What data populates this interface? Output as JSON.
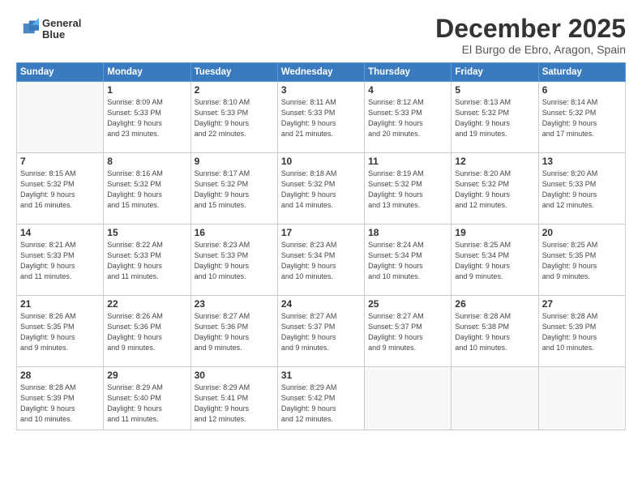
{
  "header": {
    "logo_line1": "General",
    "logo_line2": "Blue",
    "month": "December 2025",
    "location": "El Burgo de Ebro, Aragon, Spain"
  },
  "days_of_week": [
    "Sunday",
    "Monday",
    "Tuesday",
    "Wednesday",
    "Thursday",
    "Friday",
    "Saturday"
  ],
  "weeks": [
    [
      {
        "day": "",
        "info": ""
      },
      {
        "day": "1",
        "info": "Sunrise: 8:09 AM\nSunset: 5:33 PM\nDaylight: 9 hours\nand 23 minutes."
      },
      {
        "day": "2",
        "info": "Sunrise: 8:10 AM\nSunset: 5:33 PM\nDaylight: 9 hours\nand 22 minutes."
      },
      {
        "day": "3",
        "info": "Sunrise: 8:11 AM\nSunset: 5:33 PM\nDaylight: 9 hours\nand 21 minutes."
      },
      {
        "day": "4",
        "info": "Sunrise: 8:12 AM\nSunset: 5:33 PM\nDaylight: 9 hours\nand 20 minutes."
      },
      {
        "day": "5",
        "info": "Sunrise: 8:13 AM\nSunset: 5:32 PM\nDaylight: 9 hours\nand 19 minutes."
      },
      {
        "day": "6",
        "info": "Sunrise: 8:14 AM\nSunset: 5:32 PM\nDaylight: 9 hours\nand 17 minutes."
      }
    ],
    [
      {
        "day": "7",
        "info": "Sunrise: 8:15 AM\nSunset: 5:32 PM\nDaylight: 9 hours\nand 16 minutes."
      },
      {
        "day": "8",
        "info": "Sunrise: 8:16 AM\nSunset: 5:32 PM\nDaylight: 9 hours\nand 15 minutes."
      },
      {
        "day": "9",
        "info": "Sunrise: 8:17 AM\nSunset: 5:32 PM\nDaylight: 9 hours\nand 15 minutes."
      },
      {
        "day": "10",
        "info": "Sunrise: 8:18 AM\nSunset: 5:32 PM\nDaylight: 9 hours\nand 14 minutes."
      },
      {
        "day": "11",
        "info": "Sunrise: 8:19 AM\nSunset: 5:32 PM\nDaylight: 9 hours\nand 13 minutes."
      },
      {
        "day": "12",
        "info": "Sunrise: 8:20 AM\nSunset: 5:32 PM\nDaylight: 9 hours\nand 12 minutes."
      },
      {
        "day": "13",
        "info": "Sunrise: 8:20 AM\nSunset: 5:33 PM\nDaylight: 9 hours\nand 12 minutes."
      }
    ],
    [
      {
        "day": "14",
        "info": "Sunrise: 8:21 AM\nSunset: 5:33 PM\nDaylight: 9 hours\nand 11 minutes."
      },
      {
        "day": "15",
        "info": "Sunrise: 8:22 AM\nSunset: 5:33 PM\nDaylight: 9 hours\nand 11 minutes."
      },
      {
        "day": "16",
        "info": "Sunrise: 8:23 AM\nSunset: 5:33 PM\nDaylight: 9 hours\nand 10 minutes."
      },
      {
        "day": "17",
        "info": "Sunrise: 8:23 AM\nSunset: 5:34 PM\nDaylight: 9 hours\nand 10 minutes."
      },
      {
        "day": "18",
        "info": "Sunrise: 8:24 AM\nSunset: 5:34 PM\nDaylight: 9 hours\nand 10 minutes."
      },
      {
        "day": "19",
        "info": "Sunrise: 8:25 AM\nSunset: 5:34 PM\nDaylight: 9 hours\nand 9 minutes."
      },
      {
        "day": "20",
        "info": "Sunrise: 8:25 AM\nSunset: 5:35 PM\nDaylight: 9 hours\nand 9 minutes."
      }
    ],
    [
      {
        "day": "21",
        "info": "Sunrise: 8:26 AM\nSunset: 5:35 PM\nDaylight: 9 hours\nand 9 minutes."
      },
      {
        "day": "22",
        "info": "Sunrise: 8:26 AM\nSunset: 5:36 PM\nDaylight: 9 hours\nand 9 minutes."
      },
      {
        "day": "23",
        "info": "Sunrise: 8:27 AM\nSunset: 5:36 PM\nDaylight: 9 hours\nand 9 minutes."
      },
      {
        "day": "24",
        "info": "Sunrise: 8:27 AM\nSunset: 5:37 PM\nDaylight: 9 hours\nand 9 minutes."
      },
      {
        "day": "25",
        "info": "Sunrise: 8:27 AM\nSunset: 5:37 PM\nDaylight: 9 hours\nand 9 minutes."
      },
      {
        "day": "26",
        "info": "Sunrise: 8:28 AM\nSunset: 5:38 PM\nDaylight: 9 hours\nand 10 minutes."
      },
      {
        "day": "27",
        "info": "Sunrise: 8:28 AM\nSunset: 5:39 PM\nDaylight: 9 hours\nand 10 minutes."
      }
    ],
    [
      {
        "day": "28",
        "info": "Sunrise: 8:28 AM\nSunset: 5:39 PM\nDaylight: 9 hours\nand 10 minutes."
      },
      {
        "day": "29",
        "info": "Sunrise: 8:29 AM\nSunset: 5:40 PM\nDaylight: 9 hours\nand 11 minutes."
      },
      {
        "day": "30",
        "info": "Sunrise: 8:29 AM\nSunset: 5:41 PM\nDaylight: 9 hours\nand 12 minutes."
      },
      {
        "day": "31",
        "info": "Sunrise: 8:29 AM\nSunset: 5:42 PM\nDaylight: 9 hours\nand 12 minutes."
      },
      {
        "day": "",
        "info": ""
      },
      {
        "day": "",
        "info": ""
      },
      {
        "day": "",
        "info": ""
      }
    ]
  ]
}
